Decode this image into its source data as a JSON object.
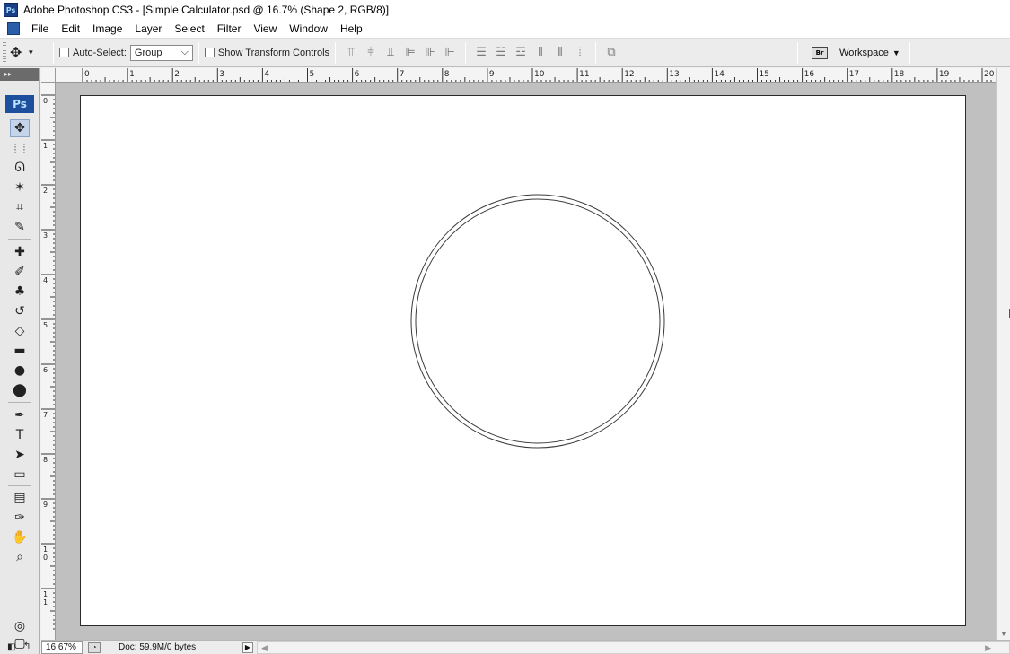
{
  "window": {
    "app_icon": "Ps",
    "title": "Adobe Photoshop CS3 - [Simple Calculator.psd @ 16.7% (Shape 2, RGB/8)]"
  },
  "menu": [
    "File",
    "Edit",
    "Image",
    "Layer",
    "Select",
    "Filter",
    "View",
    "Window",
    "Help"
  ],
  "options_bar": {
    "auto_select_label": "Auto-Select:",
    "auto_select_checked": false,
    "auto_select_value": "Group",
    "show_transform_label": "Show Transform Controls",
    "show_transform_checked": false,
    "bridge_icon": "Br",
    "workspace_label": "Workspace"
  },
  "toolbox": {
    "header": "▸▸",
    "logo": "Ps",
    "tools": [
      {
        "name": "move-tool",
        "glyph": "✥",
        "active": true
      },
      {
        "name": "marquee-tool",
        "glyph": "⬚",
        "active": false
      },
      {
        "name": "lasso-tool",
        "glyph": "ᘏ",
        "active": false
      },
      {
        "name": "magic-wand-tool",
        "glyph": "✶",
        "active": false
      },
      {
        "name": "crop-tool",
        "glyph": "⌗",
        "active": false
      },
      {
        "name": "slice-tool",
        "glyph": "✎",
        "active": false
      },
      {
        "name": "healing-brush-tool",
        "glyph": "✚",
        "active": false
      },
      {
        "name": "brush-tool",
        "glyph": "✐",
        "active": false
      },
      {
        "name": "clone-stamp-tool",
        "glyph": "♣",
        "active": false
      },
      {
        "name": "history-brush-tool",
        "glyph": "↺",
        "active": false
      },
      {
        "name": "eraser-tool",
        "glyph": "◇",
        "active": false
      },
      {
        "name": "gradient-tool",
        "glyph": "▬",
        "active": false
      },
      {
        "name": "blur-tool",
        "glyph": "●",
        "active": false
      },
      {
        "name": "dodge-tool",
        "glyph": "⬤",
        "active": false
      },
      {
        "name": "pen-tool",
        "glyph": "✒",
        "active": false
      },
      {
        "name": "type-tool",
        "glyph": "T",
        "active": false
      },
      {
        "name": "path-selection-tool",
        "glyph": "➤",
        "active": false
      },
      {
        "name": "rectangle-tool",
        "glyph": "▭",
        "active": false
      },
      {
        "name": "notes-tool",
        "glyph": "▤",
        "active": false
      },
      {
        "name": "eyedropper-tool",
        "glyph": "✑",
        "active": false
      },
      {
        "name": "hand-tool",
        "glyph": "✋",
        "active": false
      },
      {
        "name": "zoom-tool",
        "glyph": "⌕",
        "active": false
      }
    ]
  },
  "rulers": {
    "horizontal_labels": [
      "0",
      "1",
      "2",
      "3",
      "4",
      "5",
      "6",
      "7",
      "8",
      "9",
      "10",
      "11",
      "12",
      "13",
      "14",
      "15",
      "16",
      "17",
      "18",
      "19",
      "20"
    ],
    "vertical_labels": [
      "0",
      "1",
      "2",
      "3",
      "4",
      "5",
      "6",
      "7",
      "8",
      "9",
      "1 0",
      "1 1"
    ]
  },
  "status": {
    "zoom": "16.67%",
    "doc_info": "Doc: 59.9M/0 bytes"
  }
}
